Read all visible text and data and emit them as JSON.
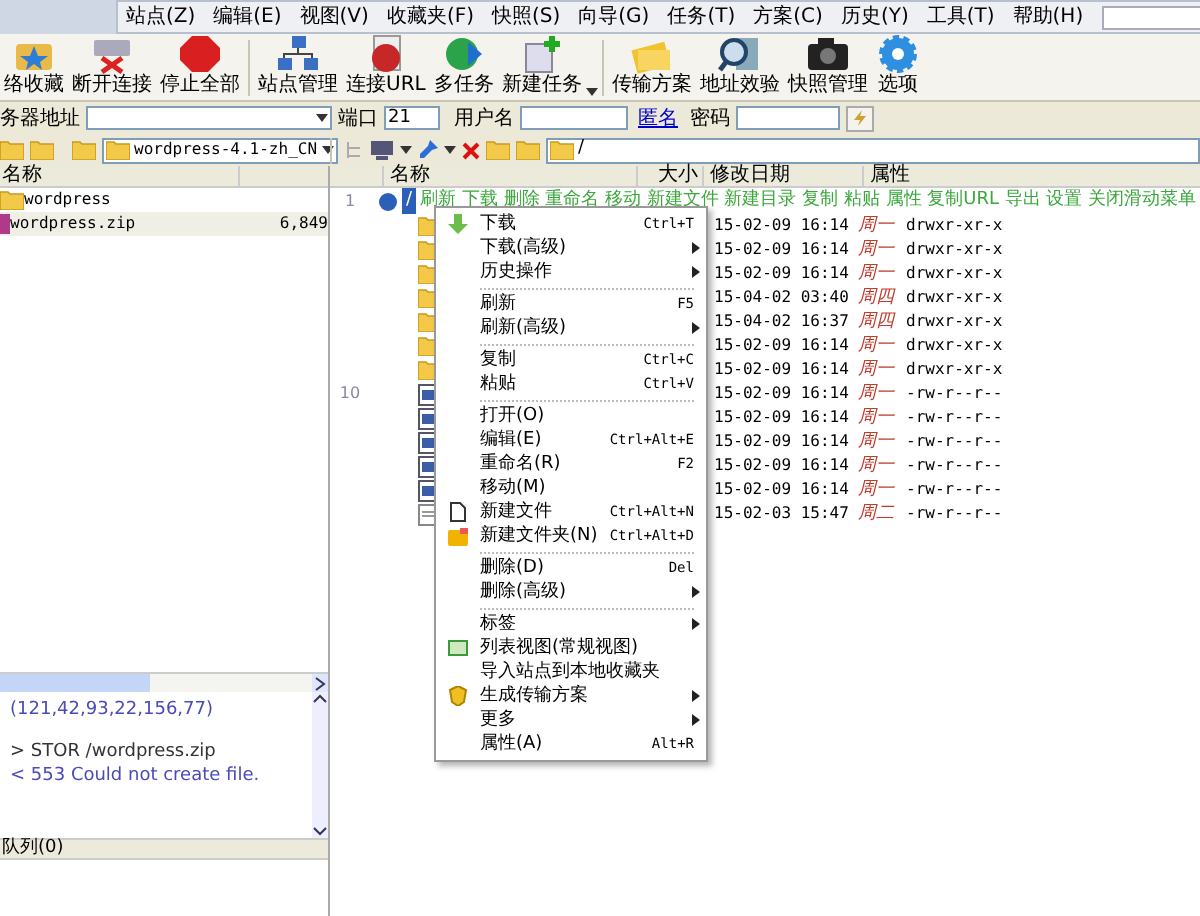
{
  "menu_bar": {
    "items": [
      "站点(Z)",
      "编辑(E)",
      "视图(V)",
      "收藏夹(F)",
      "快照(S)",
      "向导(G)",
      "任务(T)",
      "方案(C)",
      "历史(Y)",
      "工具(T)",
      "帮助(H)"
    ]
  },
  "toolbar": [
    {
      "label": "络收藏",
      "kind": "bookmark"
    },
    {
      "label": "断开连接",
      "kind": "disconnect"
    },
    {
      "label": "停止全部",
      "kind": "stop"
    },
    {
      "label": "站点管理",
      "kind": "sites"
    },
    {
      "label": "连接URL",
      "kind": "url"
    },
    {
      "label": "多任务",
      "kind": "globe"
    },
    {
      "label": "新建任务",
      "kind": "newtask"
    },
    {
      "label": "传输方案",
      "kind": "scheme"
    },
    {
      "label": "地址效验",
      "kind": "verify"
    },
    {
      "label": "快照管理",
      "kind": "camera"
    },
    {
      "label": "选项",
      "kind": "gear"
    }
  ],
  "connect_bar": {
    "server_label": "务器地址",
    "port_label": "端口",
    "port": "21",
    "user_label": "用户名",
    "anonymous_link": "匿名",
    "password_label": "密码"
  },
  "local": {
    "path": "wordpress-4.1-zh_CN",
    "columns": [
      "名称"
    ],
    "files": [
      {
        "name": "wordpress",
        "kind": "folder",
        "selected": false
      },
      {
        "name": "wordpress.zip",
        "size": "6,849",
        "kind": "zip",
        "selected": true
      }
    ]
  },
  "log": {
    "lines": [
      {
        "text": "(121,42,93,22,156,77)",
        "kind": "reply"
      },
      {
        "text": "> STOR /wordpress.zip",
        "kind": "command"
      },
      {
        "text": "< 553 Could not create file.",
        "kind": "reply"
      }
    ]
  },
  "queue": {
    "title": "队列(0)"
  },
  "remote": {
    "path": "/",
    "columns": [
      "名称",
      "大小",
      "修改日期",
      "属性"
    ],
    "gutter": [
      "1",
      "10"
    ],
    "root": {
      "name": "/",
      "actions": "刷新 下载 删除 重命名 移动 新建文件 新建目录 复制 粘贴 属性 复制URL 导出 设置 关闭滑动菜单"
    },
    "rows": [
      {
        "kind": "folder",
        "date": "15-02-09 16:14",
        "weekday": "周一",
        "attr": "drwxr-xr-x"
      },
      {
        "kind": "folder",
        "date": "15-02-09 16:14",
        "weekday": "周一",
        "attr": "drwxr-xr-x"
      },
      {
        "kind": "folder",
        "date": "15-02-09 16:14",
        "weekday": "周一",
        "attr": "drwxr-xr-x"
      },
      {
        "kind": "folder",
        "date": "15-04-02 03:40",
        "weekday": "周四",
        "attr": "drwxr-xr-x"
      },
      {
        "kind": "folder",
        "date": "15-04-02 16:37",
        "weekday": "周四",
        "attr": "drwxr-xr-x"
      },
      {
        "kind": "folder",
        "date": "15-02-09 16:14",
        "weekday": "周一",
        "attr": "drwxr-xr-x"
      },
      {
        "kind": "folder",
        "date": "15-02-09 16:14",
        "weekday": "周一",
        "attr": "drwxr-xr-x"
      },
      {
        "kind": "file",
        "date": "15-02-09 16:14",
        "weekday": "周一",
        "attr": "-rw-r--r--"
      },
      {
        "kind": "file",
        "date": "15-02-09 16:14",
        "weekday": "周一",
        "attr": "-rw-r--r--"
      },
      {
        "kind": "file",
        "date": "15-02-09 16:14",
        "weekday": "周一",
        "attr": "-rw-r--r--"
      },
      {
        "kind": "file",
        "date": "15-02-09 16:14",
        "weekday": "周一",
        "attr": "-rw-r--r--"
      },
      {
        "kind": "file",
        "date": "15-02-09 16:14",
        "weekday": "周一",
        "attr": "-rw-r--r--"
      },
      {
        "kind": "text",
        "date": "15-02-03 15:47",
        "weekday": "周二",
        "attr": "-rw-r--r--"
      }
    ]
  },
  "context_menu": [
    {
      "kind": "item",
      "label": "下载",
      "shortcut": "Ctrl+T",
      "submenu": false
    },
    {
      "kind": "item",
      "label": "下载(高级)",
      "submenu": true
    },
    {
      "kind": "item",
      "label": "历史操作",
      "submenu": true
    },
    {
      "kind": "separator"
    },
    {
      "kind": "item",
      "label": "刷新",
      "shortcut": "F5",
      "submenu": false
    },
    {
      "kind": "item",
      "label": "刷新(高级)",
      "submenu": true
    },
    {
      "kind": "separator"
    },
    {
      "kind": "item",
      "label": "复制",
      "shortcut": "Ctrl+C",
      "submenu": false
    },
    {
      "kind": "item",
      "label": "粘贴",
      "shortcut": "Ctrl+V",
      "submenu": false
    },
    {
      "kind": "separator"
    },
    {
      "kind": "item",
      "label": "打开(O)",
      "submenu": false
    },
    {
      "kind": "item",
      "label": "编辑(E)",
      "shortcut": "Ctrl+Alt+E",
      "submenu": false
    },
    {
      "kind": "item",
      "label": "重命名(R)",
      "shortcut": "F2",
      "submenu": false
    },
    {
      "kind": "item",
      "label": "移动(M)",
      "submenu": false
    },
    {
      "kind": "item",
      "label": "新建文件",
      "shortcut": "Ctrl+Alt+N",
      "submenu": false
    },
    {
      "kind": "item",
      "label": "新建文件夹(N)",
      "shortcut": "Ctrl+Alt+D",
      "submenu": false
    },
    {
      "kind": "separator"
    },
    {
      "kind": "item",
      "label": "删除(D)",
      "shortcut": "Del",
      "submenu": false
    },
    {
      "kind": "item",
      "label": "删除(高级)",
      "submenu": true
    },
    {
      "kind": "separator"
    },
    {
      "kind": "item",
      "label": "标签",
      "submenu": true
    },
    {
      "kind": "item",
      "label": "列表视图(常规视图)",
      "submenu": false
    },
    {
      "kind": "item",
      "label": "导入站点到本地收藏夹",
      "submenu": false
    },
    {
      "kind": "item",
      "label": "生成传输方案",
      "submenu": true
    },
    {
      "kind": "item",
      "label": "更多",
      "submenu": true
    },
    {
      "kind": "item",
      "label": "属性(A)",
      "shortcut": "Alt+R",
      "submenu": false
    }
  ]
}
